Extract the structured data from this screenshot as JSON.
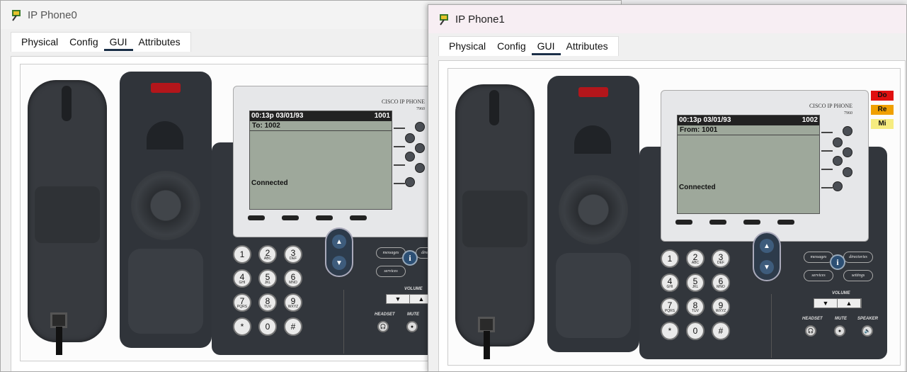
{
  "windows": [
    {
      "title": "IP Phone0",
      "tabs": [
        {
          "label": "Physical"
        },
        {
          "label": "Config"
        },
        {
          "label": "GUI"
        },
        {
          "label": "Attributes"
        }
      ],
      "active_tab": "GUI",
      "phone": {
        "brand_line1": "CISCO IP PHONE",
        "brand_line2": "7960",
        "status_time": "00:13p 03/01/93",
        "status_ext": "1001",
        "call_line": "To: 1002",
        "call_state": "Connected"
      }
    },
    {
      "title": "IP Phone1",
      "tabs": [
        {
          "label": "Physical"
        },
        {
          "label": "Config"
        },
        {
          "label": "GUI"
        },
        {
          "label": "Attributes"
        }
      ],
      "active_tab": "GUI",
      "phone": {
        "brand_line1": "CISCO IP PHONE",
        "brand_line2": "7960",
        "status_time": "00:13p 03/01/93",
        "status_ext": "1002",
        "call_line": "From: 1001",
        "call_state": "Connected"
      },
      "indicators": [
        {
          "label": "Do",
          "color": "#e01010"
        },
        {
          "label": "Re",
          "color": "#f0a000"
        },
        {
          "label": "Mi",
          "color": "#f6ec80"
        }
      ]
    }
  ],
  "keypad": [
    {
      "num": "1",
      "sub": ""
    },
    {
      "num": "2",
      "sub": "ABC"
    },
    {
      "num": "3",
      "sub": "DEF"
    },
    {
      "num": "4",
      "sub": "GHI"
    },
    {
      "num": "5",
      "sub": "JKL"
    },
    {
      "num": "6",
      "sub": "MNO"
    },
    {
      "num": "7",
      "sub": "PQRS"
    },
    {
      "num": "8",
      "sub": "TUV"
    },
    {
      "num": "9",
      "sub": "WXYZ"
    },
    {
      "num": "*",
      "sub": ""
    },
    {
      "num": "0",
      "sub": ""
    },
    {
      "num": "#",
      "sub": ""
    }
  ],
  "function_labels": {
    "messages": "messages",
    "directories": "directories",
    "services": "services",
    "settings": "settings",
    "info": "i",
    "volume": "VOLUME",
    "headset": "HEADSET",
    "mute": "MUTE",
    "speaker": "SPEAKER",
    "vol_down": "▼",
    "vol_up": "▲"
  }
}
